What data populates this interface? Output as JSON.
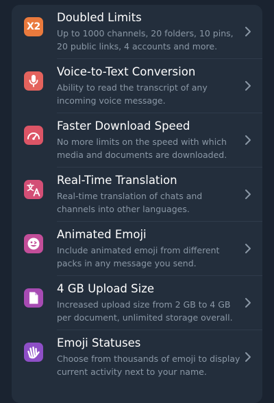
{
  "features": [
    {
      "title": "Doubled Limits",
      "description": "Up to 1000 channels, 20 folders, 10 pins, 20 public links, 4 accounts and more.",
      "icon": "x2-icon",
      "icon_text": "X2",
      "color": "#ea7a3d"
    },
    {
      "title": "Voice-to-Text Conversion",
      "description": "Ability to read the transcript of any incoming voice message.",
      "icon": "microphone-icon",
      "color": "#e4635d"
    },
    {
      "title": "Faster Download Speed",
      "description": "No more limits on the speed with which media and documents are downloaded.",
      "icon": "speedometer-icon",
      "color": "#dc5566"
    },
    {
      "title": "Real-Time Translation",
      "description": "Real-time translation of chats and channels into other languages.",
      "icon": "translate-icon",
      "color": "#d34f76"
    },
    {
      "title": "Animated Emoji",
      "description": "Include animated emoji from different packs in any message you send.",
      "icon": "emoji-icon",
      "color": "#c34e99"
    },
    {
      "title": "4 GB Upload Size",
      "description": "Increased upload size from 2 GB to 4 GB per document, unlimited storage overall.",
      "icon": "document-icon",
      "color": "#a74bb3"
    },
    {
      "title": "Emoji Statuses",
      "description": "Choose from thousands of emoji to display current activity next to your name.",
      "icon": "waving-hand-icon",
      "color": "#8e4fc7"
    }
  ],
  "colors": {
    "background": "#1a2330",
    "card": "#232e3c",
    "title": "#ffffff",
    "description": "#8b98a6",
    "chevron": "#8b98a6"
  }
}
